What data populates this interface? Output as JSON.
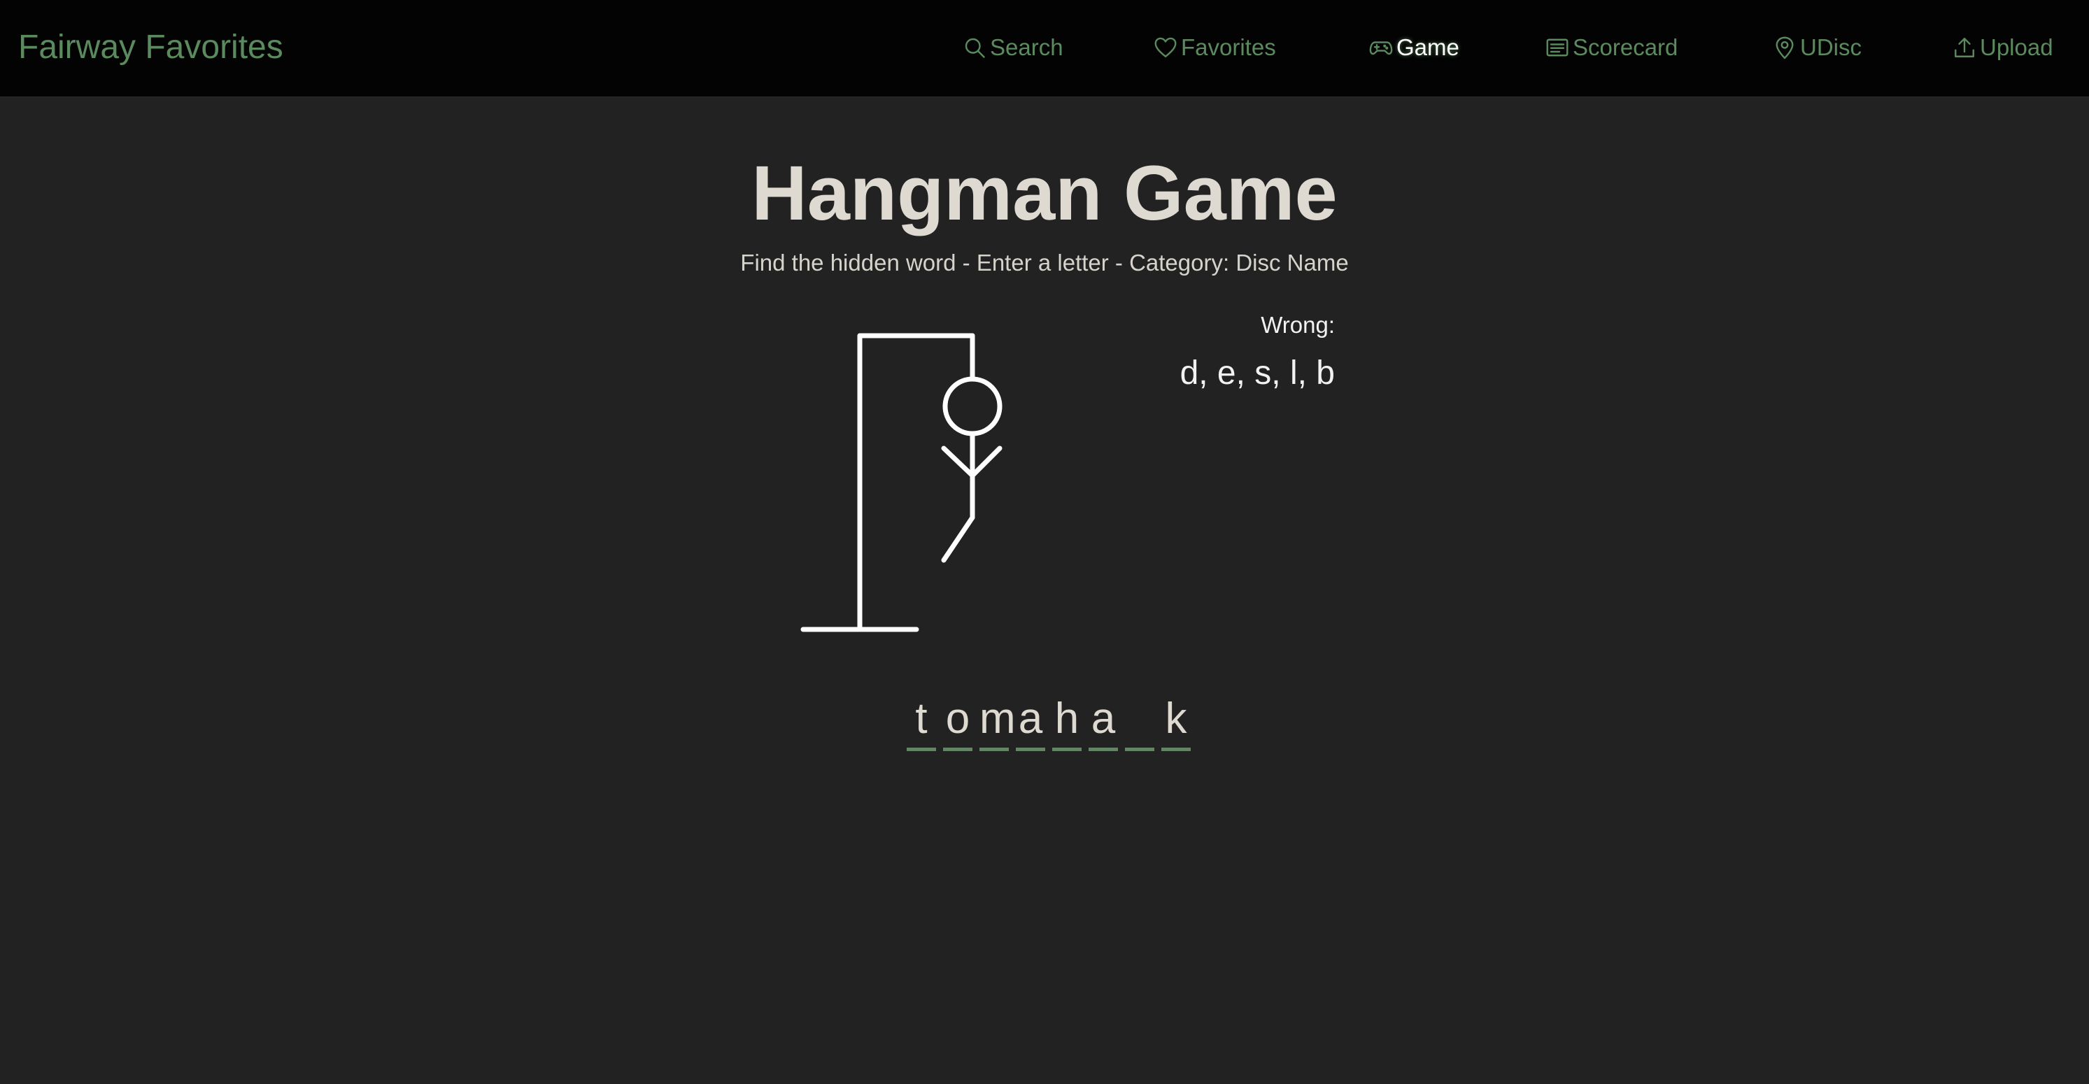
{
  "brand": "Fairway Favorites",
  "nav": [
    {
      "label": "Search",
      "icon": "search-icon"
    },
    {
      "label": "Favorites",
      "icon": "heart-icon"
    },
    {
      "label": "Game",
      "icon": "gamepad-icon",
      "active": true
    },
    {
      "label": "Scorecard",
      "icon": "scorecard-icon"
    },
    {
      "label": "UDisc",
      "icon": "location-pin-icon"
    },
    {
      "label": "Upload",
      "icon": "upload-icon"
    }
  ],
  "game": {
    "title": "Hangman Game",
    "subtitle": "Find the hidden word - Enter a letter - Category: Disc Name",
    "wrong_label": "Wrong:",
    "wrong_letters": "d, e, s, l, b",
    "word_slots": [
      "t",
      "o",
      "m",
      "a",
      "h",
      "a",
      "",
      "k"
    ]
  },
  "colors": {
    "accent": "#5b8a5e",
    "background": "#222222",
    "navbar": "#030303",
    "text": "#dedad2"
  }
}
